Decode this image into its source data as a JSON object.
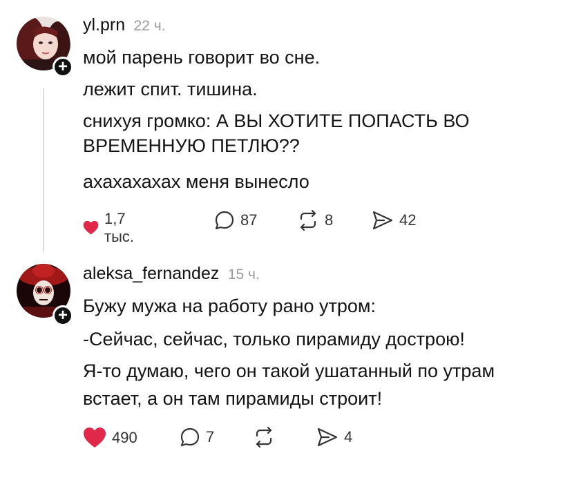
{
  "posts": [
    {
      "username": "yl.prn",
      "time": "22 ч.",
      "lines": [
        "мой парень говорит во сне.",
        "лежит спит. тишина.",
        "снихуя громко: А ВЫ ХОТИТЕ ПОПАСТЬ ВО",
        "ВРЕМЕННУЮ ПЕТЛЮ??",
        "ахахахахах меня вынесло"
      ],
      "likes": "1,7 тыс.",
      "comments": "87",
      "reposts": "8",
      "shares": "42",
      "follow_label": "+"
    },
    {
      "username": "aleksa_fernandez",
      "time": "15 ч.",
      "lines": [
        "Бужу мужа на работу рано утром:",
        "-Сейчас, сейчас, только пирамиду дострою!",
        "Я-то думаю, чего он такой ушатанный по утрам",
        "встает, а он там пирамиды строит!"
      ],
      "likes": "490",
      "comments": "7",
      "reposts": "",
      "shares": "4",
      "follow_label": "+"
    }
  ],
  "colors": {
    "like": "#e0284a",
    "icon": "#333333",
    "time": "#9a9a9a"
  },
  "icons": [
    "heart-icon",
    "comment-icon",
    "repost-icon",
    "share-icon",
    "plus-icon"
  ]
}
